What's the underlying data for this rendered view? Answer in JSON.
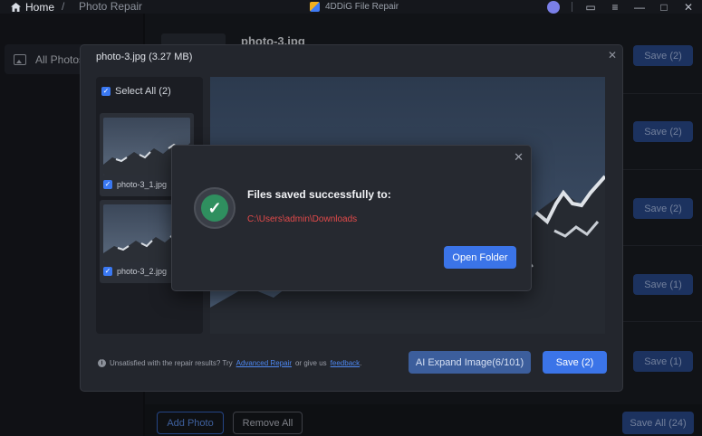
{
  "titlebar": {
    "home": "Home",
    "separator": "/",
    "breadcrumb": "Photo Repair",
    "app_name": "4DDiG File Repair"
  },
  "sidebar": {
    "items": [
      {
        "label": "All Photos",
        "icon": "image-icon"
      }
    ]
  },
  "main": {
    "item_title": "photo-3.jpg",
    "row_saves": [
      "Save (2)",
      "Save (2)",
      "Save (2)",
      "Save (1)",
      "Save (1)"
    ],
    "add_photo": "Add Photo",
    "remove_all": "Remove All",
    "save_all": "Save All (24)"
  },
  "preview": {
    "title": "photo-3.jpg  (3.27 MB)",
    "select_all": "Select All (2)",
    "thumbnails": [
      {
        "label": "photo-3_1.jpg",
        "checked": true
      },
      {
        "label": "photo-3_2.jpg",
        "checked": true
      }
    ],
    "note_prefix": "Unsatisfied with the repair results? Try",
    "advanced_repair": "Advanced Repair",
    "note_mid": "or give us",
    "feedback": "feedback",
    "note_end": ".",
    "ai_expand": "AI Expand Image(6/101)",
    "save": "Save (2)"
  },
  "modal": {
    "title": "Files saved successfully to:",
    "path": "C:\\Users\\admin\\Downloads",
    "open_folder": "Open Folder"
  },
  "colors": {
    "accent": "#3b74e8",
    "success": "#2f8f5f",
    "path": "#e24a4a",
    "link": "#4d87f0"
  }
}
